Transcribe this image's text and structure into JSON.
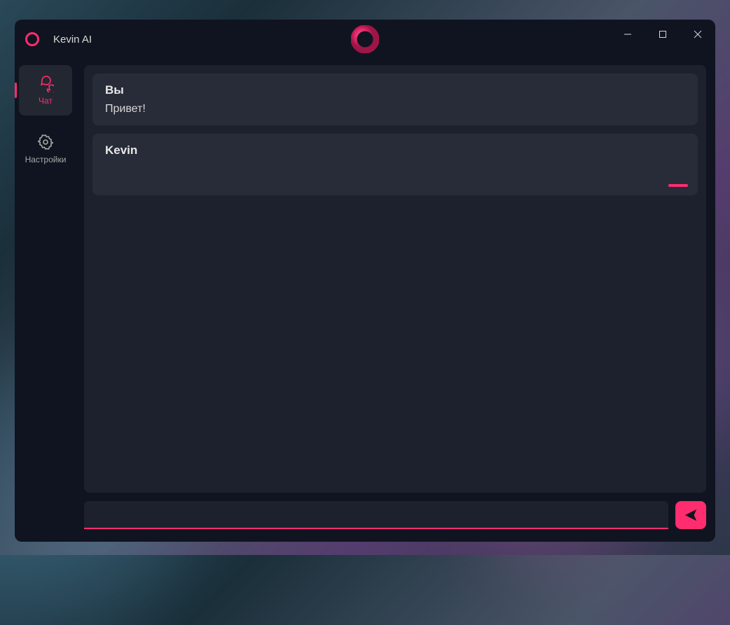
{
  "app": {
    "title": "Kevin AI"
  },
  "sidebar": {
    "items": [
      {
        "label": "Чат",
        "icon": "chat"
      },
      {
        "label": "Настройки",
        "icon": "gear"
      }
    ]
  },
  "chat": {
    "messages": [
      {
        "sender": "Вы",
        "text": "Привет!"
      },
      {
        "sender": "Kevin",
        "text": ""
      }
    ],
    "input_value": "",
    "input_placeholder": ""
  },
  "colors": {
    "accent": "#ff2d6f",
    "bg_window": "#101420",
    "bg_panel": "#1d212d",
    "bg_msg": "#282c38"
  }
}
